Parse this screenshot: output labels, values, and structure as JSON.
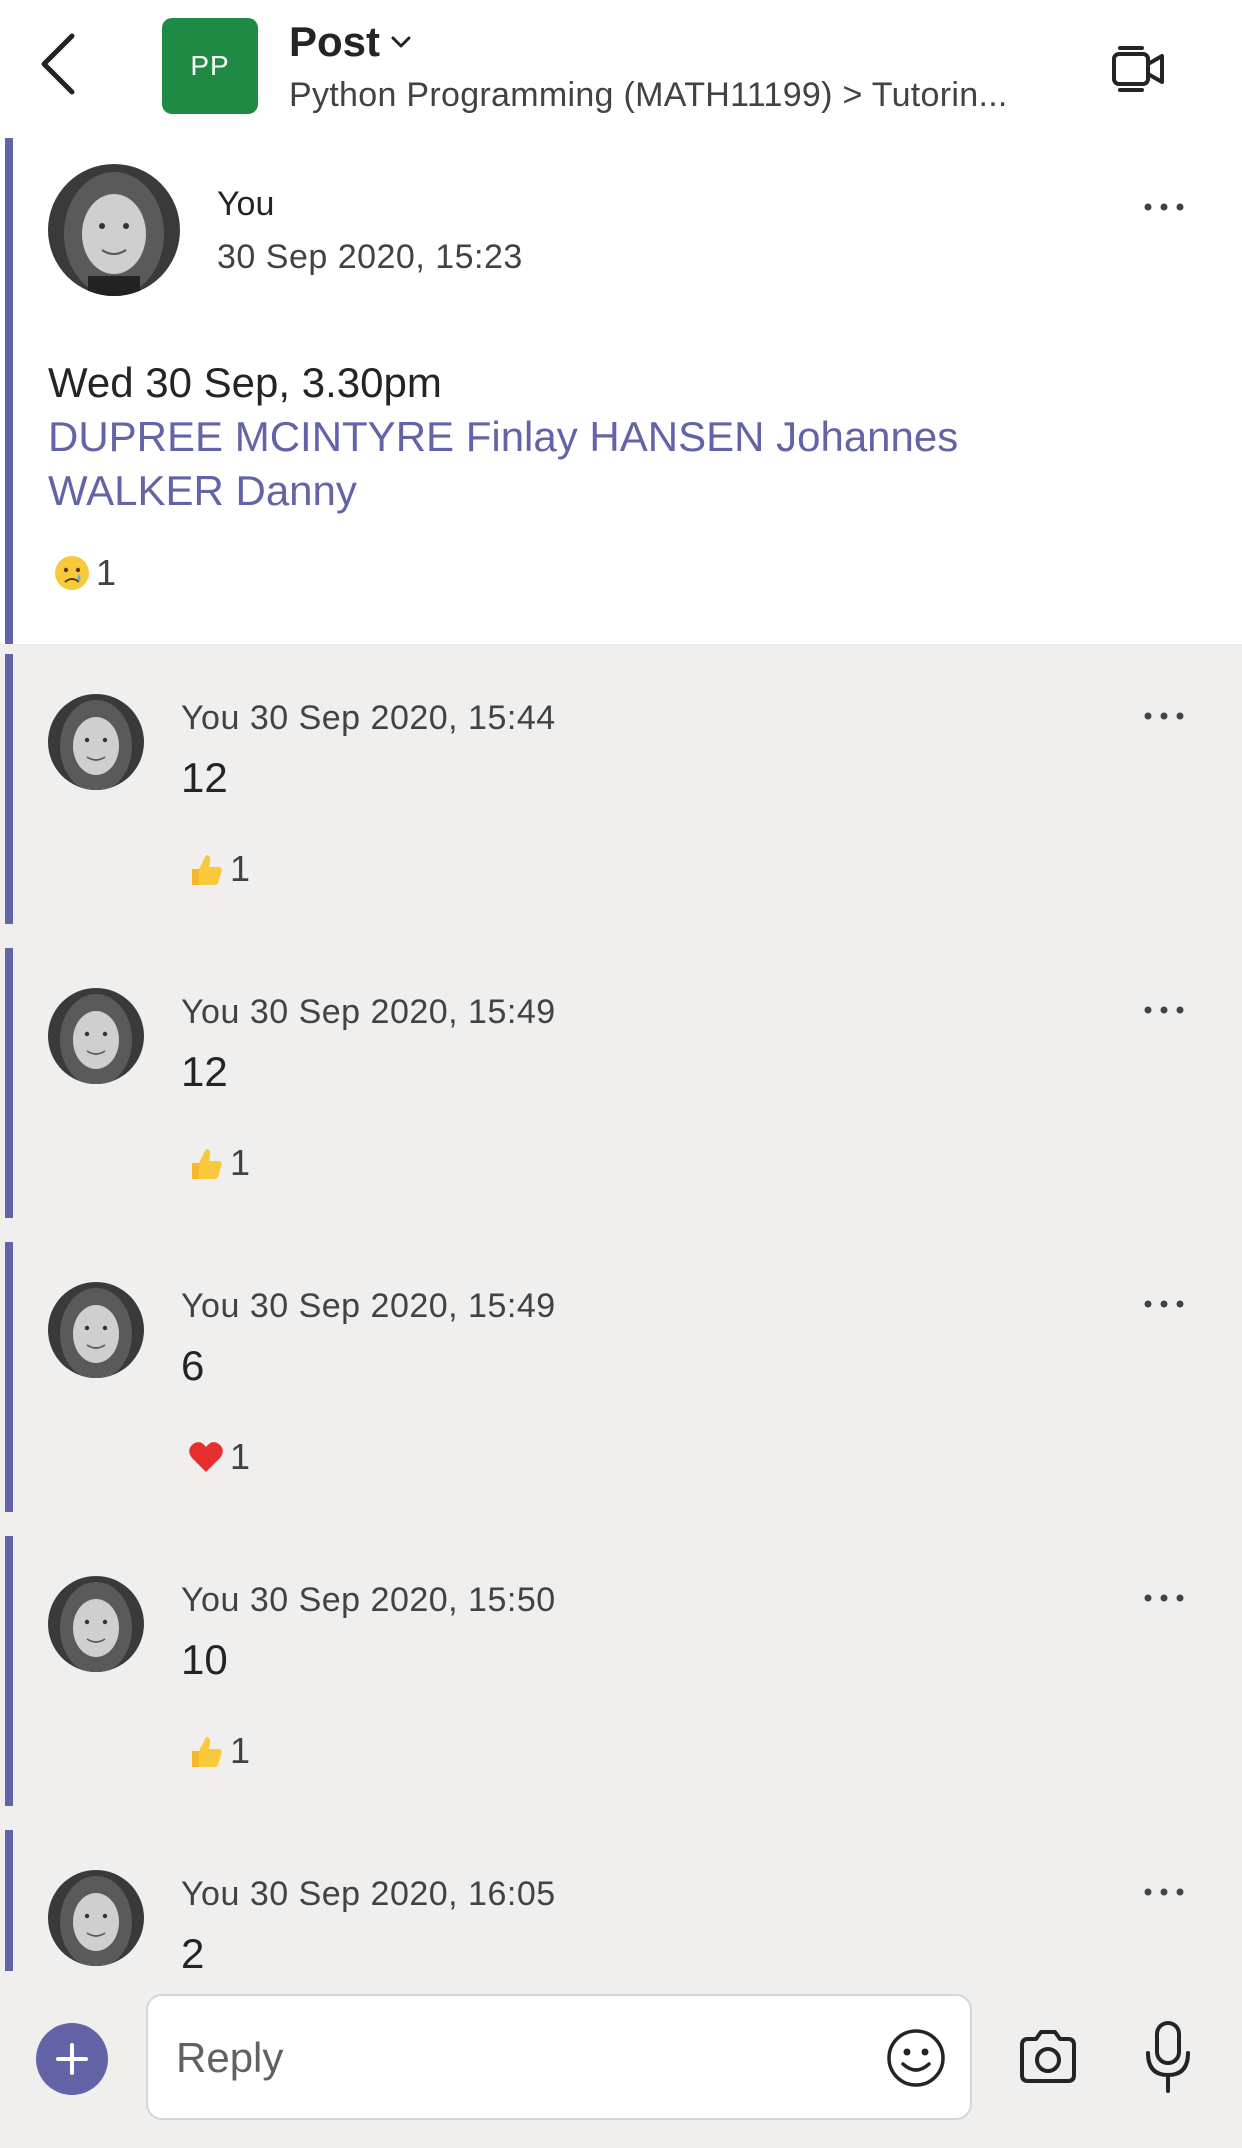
{
  "header": {
    "team_initials": "PP",
    "title": "Post",
    "breadcrumb": "Python Programming (MATH11199) > Tutorin..."
  },
  "root_post": {
    "author": "You",
    "timestamp": "30 Sep 2020, 15:23",
    "text_line": "Wed 30 Sep, 3.30pm",
    "mentions_line1": "DUPREE MCINTYRE Finlay HANSEN Johannes",
    "mentions_line2": "WALKER Danny",
    "reaction": {
      "emoji": "sad-face",
      "count": "1"
    }
  },
  "replies": [
    {
      "meta": "You 30 Sep 2020, 15:44",
      "text": "12",
      "reaction": {
        "emoji": "thumbs-up",
        "count": "1"
      }
    },
    {
      "meta": "You 30 Sep 2020, 15:49",
      "text": "12",
      "reaction": {
        "emoji": "thumbs-up",
        "count": "1"
      }
    },
    {
      "meta": "You 30 Sep 2020, 15:49",
      "text": "6",
      "reaction": {
        "emoji": "heart",
        "count": "1"
      }
    },
    {
      "meta": "You 30 Sep 2020, 15:50",
      "text": "10",
      "reaction": {
        "emoji": "thumbs-up",
        "count": "1"
      }
    },
    {
      "meta": "You 30 Sep 2020, 16:05",
      "text": "2"
    }
  ],
  "compose": {
    "placeholder": "Reply"
  },
  "colors": {
    "accent": "#6264a7",
    "team_tile": "#1f8a44",
    "feed_bg": "#f1efee"
  }
}
